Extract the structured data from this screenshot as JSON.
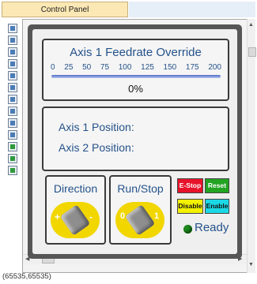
{
  "tab": {
    "label": "Control Panel"
  },
  "toolbox": {
    "icons": [
      "select-tool-icon",
      "text-tool-icon",
      "button-tool-icon",
      "panel-tool-icon",
      "table-tool-icon",
      "grid-tool-icon",
      "chart-tool-icon",
      "list-tool-icon",
      "bar-tool-icon",
      "gauge-tool-icon",
      "layer-tool-icon",
      "image-tool-icon",
      "refresh-tool-icon"
    ]
  },
  "feedrate": {
    "title": "Axis 1 Feedrate Override",
    "scale": [
      "0",
      "25",
      "50",
      "75",
      "100",
      "125",
      "150",
      "175",
      "200"
    ],
    "value_text": "0%",
    "value": 0
  },
  "positions": {
    "axis1": "Axis 1 Position:",
    "axis2": "Axis 2 Position:"
  },
  "direction": {
    "label": "Direction",
    "left": "+",
    "right": "-"
  },
  "runstop": {
    "label": "Run/Stop",
    "left": "0",
    "right": "1"
  },
  "buttons": {
    "estop": "E-Stop",
    "reset": "Reset",
    "disable": "Disable",
    "enable": "Enable"
  },
  "status": {
    "text": "Ready",
    "led_color": "#1e8a1e"
  },
  "colors": {
    "estop": "#e8132a",
    "reset": "#22a322",
    "disable": "#f3f000",
    "enable": "#1cd8e6",
    "text_blue": "#24528a"
  },
  "coords": "(65535,65535)"
}
